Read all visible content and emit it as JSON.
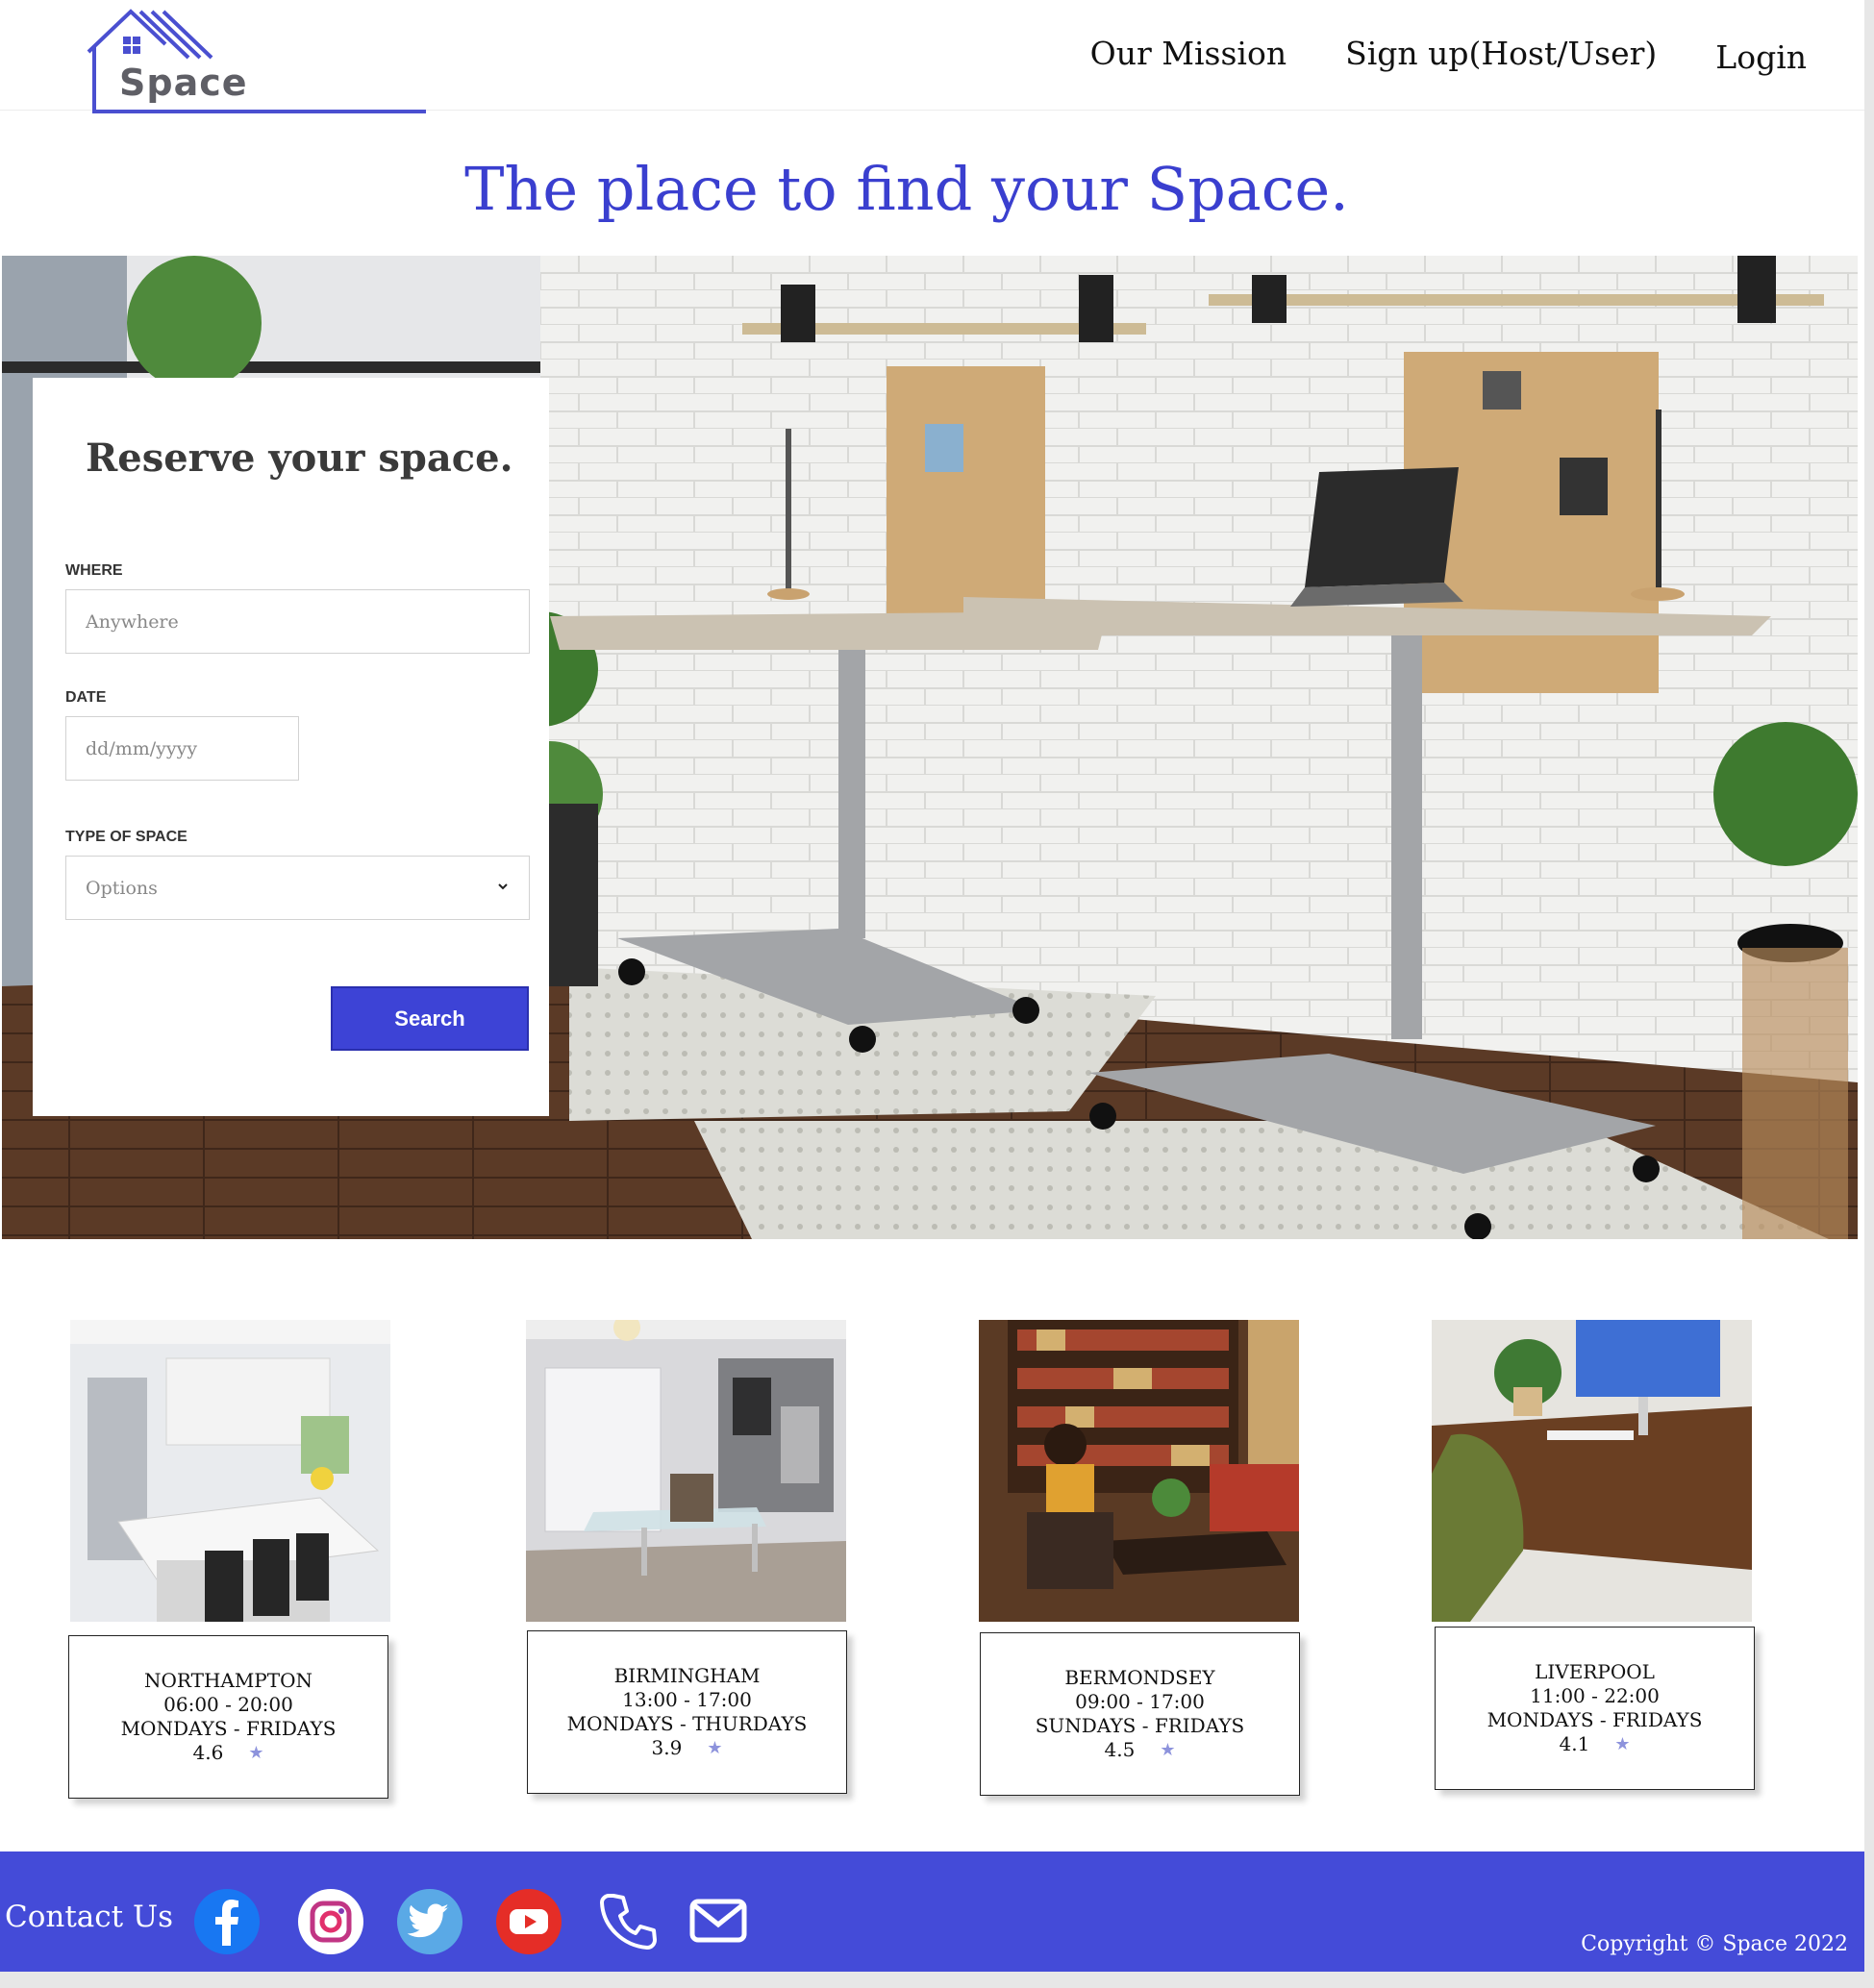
{
  "brand": {
    "name": "Space",
    "accent": "#3d43d6",
    "logo_color": "#4a4fd0"
  },
  "nav": {
    "mission": "Our Mission",
    "signup": "Sign up(Host/User)",
    "login": "Login"
  },
  "hero": {
    "heading": "The place to find your Space."
  },
  "reserve": {
    "title": "Reserve your space.",
    "where_label": "WHERE",
    "where_placeholder": "Anywhere",
    "date_label": "DATE",
    "date_placeholder": "dd/mm/yyyy",
    "type_label": "TYPE OF SPACE",
    "type_selected": "Options",
    "search_label": "Search"
  },
  "listings": [
    {
      "city": "NORTHAMPTON",
      "hours": "06:00 - 20:00",
      "days": "MONDAYS - FRIDAYS",
      "rating": "4.6",
      "image": "kitchen-photo"
    },
    {
      "city": "BIRMINGHAM",
      "hours": "13:00 - 17:00",
      "days": "MONDAYS - THURDAYS",
      "rating": "3.9",
      "image": "study-room-photo"
    },
    {
      "city": "BERMONDSEY",
      "hours": "09:00 - 17:00",
      "days": "SUNDAYS - FRIDAYS",
      "rating": "4.5",
      "image": "library-photo"
    },
    {
      "city": "LIVERPOOL",
      "hours": "11:00 - 22:00",
      "days": "MONDAYS - FRIDAYS",
      "rating": "4.1",
      "image": "desk-photo"
    }
  ],
  "rating_icon": "star-icon",
  "footer": {
    "contact": "Contact Us",
    "icons": [
      "facebook-icon",
      "instagram-icon",
      "twitter-icon",
      "youtube-icon",
      "phone-icon",
      "mail-icon"
    ],
    "copyright": "Copyright © Space 2022",
    "background": "#444bd8"
  }
}
